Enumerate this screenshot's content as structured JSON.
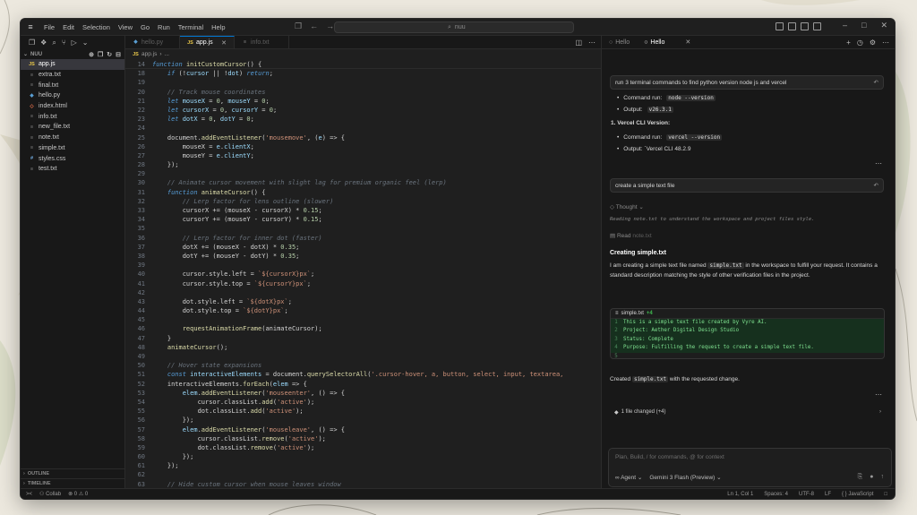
{
  "titlebar": {
    "menu": [
      "File",
      "Edit",
      "Selection",
      "View",
      "Go",
      "Run",
      "Terminal",
      "Help"
    ],
    "search": "nuu"
  },
  "explorer": {
    "folder": "NUU",
    "files": [
      {
        "name": "app.js",
        "type": "js",
        "active": true
      },
      {
        "name": "extra.txt",
        "type": "txt"
      },
      {
        "name": "final.txt",
        "type": "txt"
      },
      {
        "name": "hello.py",
        "type": "py"
      },
      {
        "name": "index.html",
        "type": "html"
      },
      {
        "name": "info.txt",
        "type": "txt"
      },
      {
        "name": "new_file.txt",
        "type": "txt"
      },
      {
        "name": "note.txt",
        "type": "txt"
      },
      {
        "name": "simple.txt",
        "type": "txt"
      },
      {
        "name": "styles.css",
        "type": "css"
      },
      {
        "name": "test.txt",
        "type": "txt"
      }
    ],
    "outline": "OUTLINE",
    "timeline": "TIMELINE"
  },
  "editor": {
    "tabs": [
      {
        "label": "hello.py",
        "active": false
      },
      {
        "label": "app.js",
        "active": true
      },
      {
        "label": "info.txt",
        "active": false
      }
    ],
    "breadcrumb": [
      "app.js",
      "..."
    ],
    "lines": [
      {
        "n": "14",
        "t": [
          [
            "kw",
            "function "
          ],
          [
            "fn",
            "initCustomCursor"
          ],
          [
            "tx",
            "() {"
          ]
        ]
      },
      {
        "n": "18",
        "t": [
          [
            "tx",
            "    "
          ],
          [
            "kw",
            "if"
          ],
          [
            "tx",
            " (!"
          ],
          [
            "vr",
            "cursor"
          ],
          [
            "tx",
            " || !"
          ],
          [
            "vr",
            "dot"
          ],
          [
            "tx",
            ") "
          ],
          [
            "kw",
            "return"
          ],
          [
            "tx",
            ";"
          ]
        ]
      },
      {
        "n": "19",
        "t": []
      },
      {
        "n": "20",
        "t": [
          [
            "cm",
            "    // Track mouse coordinates"
          ]
        ]
      },
      {
        "n": "21",
        "t": [
          [
            "tx",
            "    "
          ],
          [
            "kw",
            "let "
          ],
          [
            "vr",
            "mouseX"
          ],
          [
            "tx",
            " = "
          ],
          [
            "nm",
            "0"
          ],
          [
            "tx",
            ", "
          ],
          [
            "vr",
            "mouseY"
          ],
          [
            "tx",
            " = "
          ],
          [
            "nm",
            "0"
          ],
          [
            "tx",
            ";"
          ]
        ]
      },
      {
        "n": "22",
        "t": [
          [
            "tx",
            "    "
          ],
          [
            "kw",
            "let "
          ],
          [
            "vr",
            "cursorX"
          ],
          [
            "tx",
            " = "
          ],
          [
            "nm",
            "0"
          ],
          [
            "tx",
            ", "
          ],
          [
            "vr",
            "cursorY"
          ],
          [
            "tx",
            " = "
          ],
          [
            "nm",
            "0"
          ],
          [
            "tx",
            ";"
          ]
        ]
      },
      {
        "n": "23",
        "t": [
          [
            "tx",
            "    "
          ],
          [
            "kw",
            "let "
          ],
          [
            "vr",
            "dotX"
          ],
          [
            "tx",
            " = "
          ],
          [
            "nm",
            "0"
          ],
          [
            "tx",
            ", "
          ],
          [
            "vr",
            "dotY"
          ],
          [
            "tx",
            " = "
          ],
          [
            "nm",
            "0"
          ],
          [
            "tx",
            ";"
          ]
        ]
      },
      {
        "n": "24",
        "t": []
      },
      {
        "n": "25",
        "t": [
          [
            "tx",
            "    document."
          ],
          [
            "fn",
            "addEventListener"
          ],
          [
            "tx",
            "("
          ],
          [
            "st",
            "'mousemove'"
          ],
          [
            "tx",
            ", ("
          ],
          [
            "vr",
            "e"
          ],
          [
            "tx",
            ") => {"
          ]
        ]
      },
      {
        "n": "26",
        "t": [
          [
            "tx",
            "        mouseX = "
          ],
          [
            "vr",
            "e"
          ],
          [
            "tx",
            "."
          ],
          [
            "vr",
            "clientX"
          ],
          [
            "tx",
            ";"
          ]
        ]
      },
      {
        "n": "27",
        "t": [
          [
            "tx",
            "        mouseY = "
          ],
          [
            "vr",
            "e"
          ],
          [
            "tx",
            "."
          ],
          [
            "vr",
            "clientY"
          ],
          [
            "tx",
            ";"
          ]
        ]
      },
      {
        "n": "28",
        "t": [
          [
            "tx",
            "    });"
          ]
        ]
      },
      {
        "n": "29",
        "t": []
      },
      {
        "n": "30",
        "t": [
          [
            "cm",
            "    // Animate cursor movement with slight lag for premium organic feel (lerp)"
          ]
        ]
      },
      {
        "n": "31",
        "t": [
          [
            "tx",
            "    "
          ],
          [
            "kw",
            "function "
          ],
          [
            "fn",
            "animateCursor"
          ],
          [
            "tx",
            "() {"
          ]
        ]
      },
      {
        "n": "32",
        "t": [
          [
            "cm",
            "        // Lerp factor for lens outline (slower)"
          ]
        ]
      },
      {
        "n": "33",
        "t": [
          [
            "tx",
            "        cursorX += (mouseX - cursorX) * "
          ],
          [
            "nm",
            "0.15"
          ],
          [
            "tx",
            ";"
          ]
        ]
      },
      {
        "n": "34",
        "t": [
          [
            "tx",
            "        cursorY += (mouseY - cursorY) * "
          ],
          [
            "nm",
            "0.15"
          ],
          [
            "tx",
            ";"
          ]
        ]
      },
      {
        "n": "35",
        "t": []
      },
      {
        "n": "36",
        "t": [
          [
            "cm",
            "        // Lerp factor for inner dot (faster)"
          ]
        ]
      },
      {
        "n": "37",
        "t": [
          [
            "tx",
            "        dotX += (mouseX - dotX) * "
          ],
          [
            "nm",
            "0.35"
          ],
          [
            "tx",
            ";"
          ]
        ]
      },
      {
        "n": "38",
        "t": [
          [
            "tx",
            "        dotY += (mouseY - dotY) * "
          ],
          [
            "nm",
            "0.35"
          ],
          [
            "tx",
            ";"
          ]
        ]
      },
      {
        "n": "39",
        "t": []
      },
      {
        "n": "40",
        "t": [
          [
            "tx",
            "        cursor.style.left = "
          ],
          [
            "st",
            "`${cursorX}px`"
          ],
          [
            "tx",
            ";"
          ]
        ]
      },
      {
        "n": "41",
        "t": [
          [
            "tx",
            "        cursor.style.top = "
          ],
          [
            "st",
            "`${cursorY}px`"
          ],
          [
            "tx",
            ";"
          ]
        ]
      },
      {
        "n": "42",
        "t": []
      },
      {
        "n": "43",
        "t": [
          [
            "tx",
            "        dot.style.left = "
          ],
          [
            "st",
            "`${dotX}px`"
          ],
          [
            "tx",
            ";"
          ]
        ]
      },
      {
        "n": "44",
        "t": [
          [
            "tx",
            "        dot.style.top = "
          ],
          [
            "st",
            "`${dotY}px`"
          ],
          [
            "tx",
            ";"
          ]
        ]
      },
      {
        "n": "45",
        "t": []
      },
      {
        "n": "46",
        "t": [
          [
            "tx",
            "        "
          ],
          [
            "fn",
            "requestAnimationFrame"
          ],
          [
            "tx",
            "(animateCursor);"
          ]
        ]
      },
      {
        "n": "47",
        "t": [
          [
            "tx",
            "    }"
          ]
        ]
      },
      {
        "n": "48",
        "t": [
          [
            "tx",
            "    "
          ],
          [
            "fn",
            "animateCursor"
          ],
          [
            "tx",
            "();"
          ]
        ]
      },
      {
        "n": "49",
        "t": []
      },
      {
        "n": "50",
        "t": [
          [
            "cm",
            "    // Hover state expansions"
          ]
        ]
      },
      {
        "n": "51",
        "t": [
          [
            "tx",
            "    "
          ],
          [
            "kw",
            "const "
          ],
          [
            "vr",
            "interactiveElements"
          ],
          [
            "tx",
            " = document."
          ],
          [
            "fn",
            "querySelectorAll"
          ],
          [
            "tx",
            "("
          ],
          [
            "st",
            "'.cursor-hover, a, button, select, input, textarea,"
          ]
        ]
      },
      {
        "n": "52",
        "t": [
          [
            "tx",
            "    interactiveElements."
          ],
          [
            "fn",
            "forEach"
          ],
          [
            "tx",
            "("
          ],
          [
            "vr",
            "elem"
          ],
          [
            "tx",
            " => {"
          ]
        ]
      },
      {
        "n": "53",
        "t": [
          [
            "tx",
            "        "
          ],
          [
            "vr",
            "elem"
          ],
          [
            "tx",
            "."
          ],
          [
            "fn",
            "addEventListener"
          ],
          [
            "tx",
            "("
          ],
          [
            "st",
            "'mouseenter'"
          ],
          [
            "tx",
            ", () => {"
          ]
        ]
      },
      {
        "n": "54",
        "t": [
          [
            "tx",
            "            cursor.classList."
          ],
          [
            "fn",
            "add"
          ],
          [
            "tx",
            "("
          ],
          [
            "st",
            "'active'"
          ],
          [
            "tx",
            ");"
          ]
        ]
      },
      {
        "n": "55",
        "t": [
          [
            "tx",
            "            dot.classList."
          ],
          [
            "fn",
            "add"
          ],
          [
            "tx",
            "("
          ],
          [
            "st",
            "'active'"
          ],
          [
            "tx",
            ");"
          ]
        ]
      },
      {
        "n": "56",
        "t": [
          [
            "tx",
            "        });"
          ]
        ]
      },
      {
        "n": "57",
        "t": [
          [
            "tx",
            "        "
          ],
          [
            "vr",
            "elem"
          ],
          [
            "tx",
            "."
          ],
          [
            "fn",
            "addEventListener"
          ],
          [
            "tx",
            "("
          ],
          [
            "st",
            "'mouseleave'"
          ],
          [
            "tx",
            ", () => {"
          ]
        ]
      },
      {
        "n": "58",
        "t": [
          [
            "tx",
            "            cursor.classList."
          ],
          [
            "fn",
            "remove"
          ],
          [
            "tx",
            "("
          ],
          [
            "st",
            "'active'"
          ],
          [
            "tx",
            ");"
          ]
        ]
      },
      {
        "n": "59",
        "t": [
          [
            "tx",
            "            dot.classList."
          ],
          [
            "fn",
            "remove"
          ],
          [
            "tx",
            "("
          ],
          [
            "st",
            "'active'"
          ],
          [
            "tx",
            ");"
          ]
        ]
      },
      {
        "n": "60",
        "t": [
          [
            "tx",
            "        });"
          ]
        ]
      },
      {
        "n": "61",
        "t": [
          [
            "tx",
            "    });"
          ]
        ]
      },
      {
        "n": "62",
        "t": []
      },
      {
        "n": "63",
        "t": [
          [
            "cm",
            "    // Hide custom cursor when mouse leaves window"
          ]
        ]
      }
    ]
  },
  "chat": {
    "tabs": [
      {
        "label": "Hello",
        "active": false
      },
      {
        "label": "Hello",
        "active": true
      }
    ],
    "prompt1": "run 3 terminal commands to find python version node js and vercel",
    "node_cmd_label": "Command run:",
    "node_cmd": "node --version",
    "node_out_label": "Output:",
    "node_out": "v26.3.1",
    "vercel_heading": "1.  Vercel CLI Version:",
    "vercel_cmd_label": "Command run:",
    "vercel_cmd": "vercel --version",
    "vercel_out": "Output: `Vercel CLI 48.2.9",
    "prompt2": "create a simple text file",
    "thought_label": "Thought",
    "thought_text": "Reading note.txt to understand the workspace and project files style.",
    "read_label": "Read",
    "read_file": "note.txt",
    "creating_heading": "Creating simple.txt",
    "creating_pre": "I am creating a simple text file named ",
    "creating_file": "simple.txt",
    "creating_post": " in the workspace to fulfill your request. It contains a standard description matching the style of other verification files in the project.",
    "card_file": "simple.txt",
    "card_plus": "+4",
    "diff": [
      {
        "n": "1",
        "t": "This is a simple text file created by Vyre AI."
      },
      {
        "n": "2",
        "t": "Project: Aether Digital Design Studio"
      },
      {
        "n": "3",
        "t": "Status: Complete"
      },
      {
        "n": "4",
        "t": "Purpose: Fulfilling the request to create a simple text file."
      },
      {
        "n": "5",
        "t": ""
      }
    ],
    "created_pre": "Created ",
    "created_file": "simple.txt",
    "created_post": " with the requested change.",
    "changes": "1 file changed (+4)",
    "input_placeholder": "Plan, Build, / for commands, @ for context",
    "agent_label": "Agent",
    "model_label": "Gemini 3 Flash (Preview)"
  },
  "statusbar": {
    "left": [
      "Collab",
      "0",
      "0"
    ],
    "position": "Ln 1, Col 1",
    "spaces": "Spaces: 4",
    "encoding": "UTF-8",
    "eol": "LF",
    "lang": "JavaScript"
  },
  "colors": {
    "accent": "#0078d4",
    "diff_add": "#7ee08f"
  }
}
